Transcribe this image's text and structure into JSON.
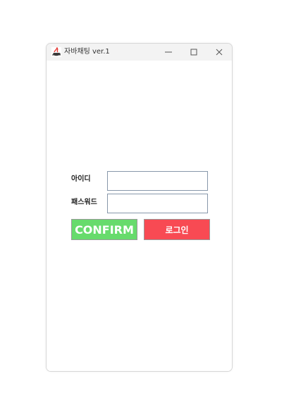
{
  "window": {
    "title": "자바채팅 ver.1",
    "icon": "java-coffee-icon",
    "controls": {
      "minimize": "minimize-icon",
      "maximize": "maximize-icon",
      "close": "close-icon"
    }
  },
  "form": {
    "id_label": "아이디",
    "password_label": "패스워드",
    "id_value": "",
    "password_value": "",
    "confirm_label": "CONFIRM",
    "login_label": "로그인"
  },
  "colors": {
    "titlebar": "#f3f3f3",
    "window_background": "#ffffff",
    "field_border": "#8797aa",
    "confirm_button": "#67db6c",
    "login_button": "#f84a53",
    "button_text": "#ffffff"
  }
}
